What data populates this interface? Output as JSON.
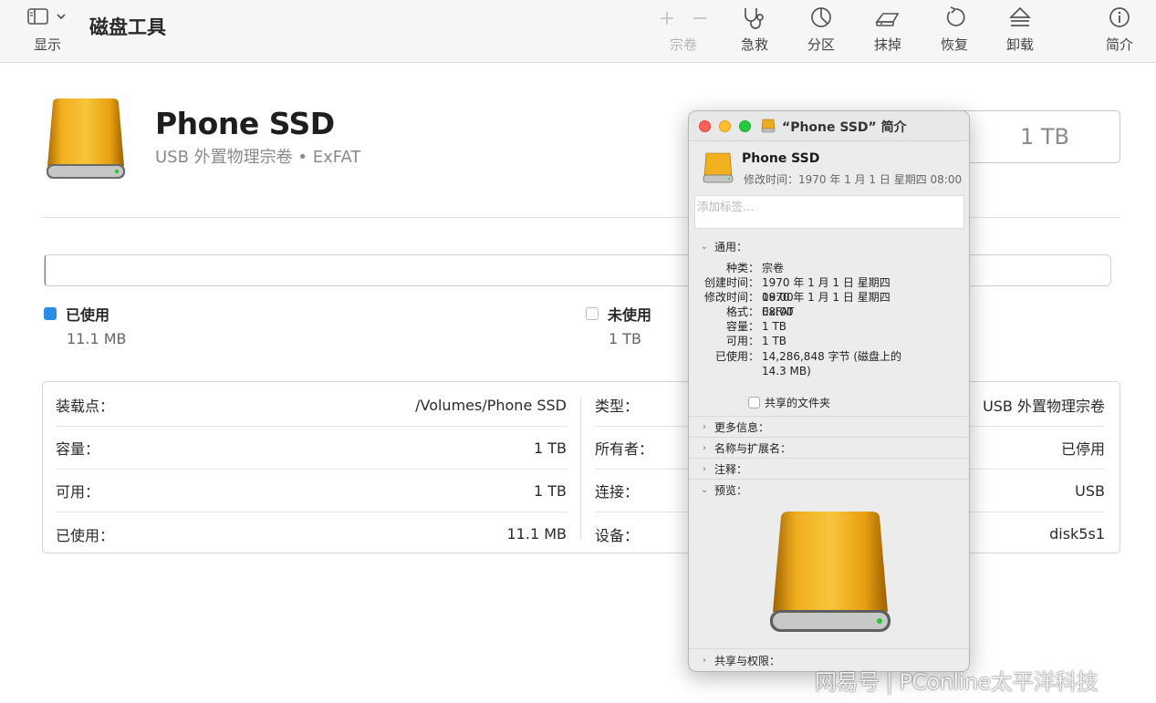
{
  "toolbar": {
    "view_label": "显示",
    "app_title": "磁盘工具",
    "volume_label": "宗卷",
    "first_aid_label": "急救",
    "partition_label": "分区",
    "erase_label": "抹掉",
    "restore_label": "恢复",
    "unmount_label": "卸载",
    "info_label": "简介"
  },
  "disk": {
    "name": "Phone SSD",
    "subtitle": "USB 外置物理宗卷 • ExFAT",
    "capacity": "1 TB"
  },
  "usage": {
    "used_fraction": 1.11e-05,
    "used_label": "已使用",
    "used_value": "11.1 MB",
    "free_label": "未使用",
    "free_value": "1 TB",
    "used_color": "#2c8de8"
  },
  "info_table": {
    "left": [
      {
        "key": "装载点：",
        "value": "/Volumes/Phone SSD"
      },
      {
        "key": "容量：",
        "value": "1 TB"
      },
      {
        "key": "可用：",
        "value": "1 TB"
      },
      {
        "key": "已使用：",
        "value": "11.1 MB"
      }
    ],
    "right": [
      {
        "key": "类型：",
        "value": "USB 外置物理宗卷"
      },
      {
        "key": "所有者：",
        "value": "已停用"
      },
      {
        "key": "连接：",
        "value": "USB"
      },
      {
        "key": "设备：",
        "value": "disk5s1"
      }
    ]
  },
  "info_window": {
    "title": "“Phone SSD” 简介",
    "name": "Phone SSD",
    "modified": "修改时间：1970 年 1 月 1 日 星期四 08:00",
    "tags_placeholder": "添加标签…",
    "general_header": "通用：",
    "general": [
      {
        "key": "种类：",
        "value": "宗卷"
      },
      {
        "key": "创建时间：",
        "value": "1970 年 1 月 1 日 星期四 08:00"
      },
      {
        "key": "修改时间：",
        "value": "1970 年 1 月 1 日 星期四 08:00"
      },
      {
        "key": "格式：",
        "value": "ExFAT"
      },
      {
        "key": "容量：",
        "value": "1 TB"
      },
      {
        "key": "可用：",
        "value": "1 TB"
      },
      {
        "key": "已使用：",
        "value": "14,286,848 字节 (磁盘上的"
      },
      {
        "key": "",
        "value": "14.3 MB)"
      }
    ],
    "shared_folder_label": "共享的文件夹",
    "more_info": "更多信息：",
    "name_ext": "名称与扩展名：",
    "comments": "注释：",
    "preview": "预览：",
    "sharing": "共享与权限："
  },
  "watermark": "网易号 | PConline太平洋科技"
}
